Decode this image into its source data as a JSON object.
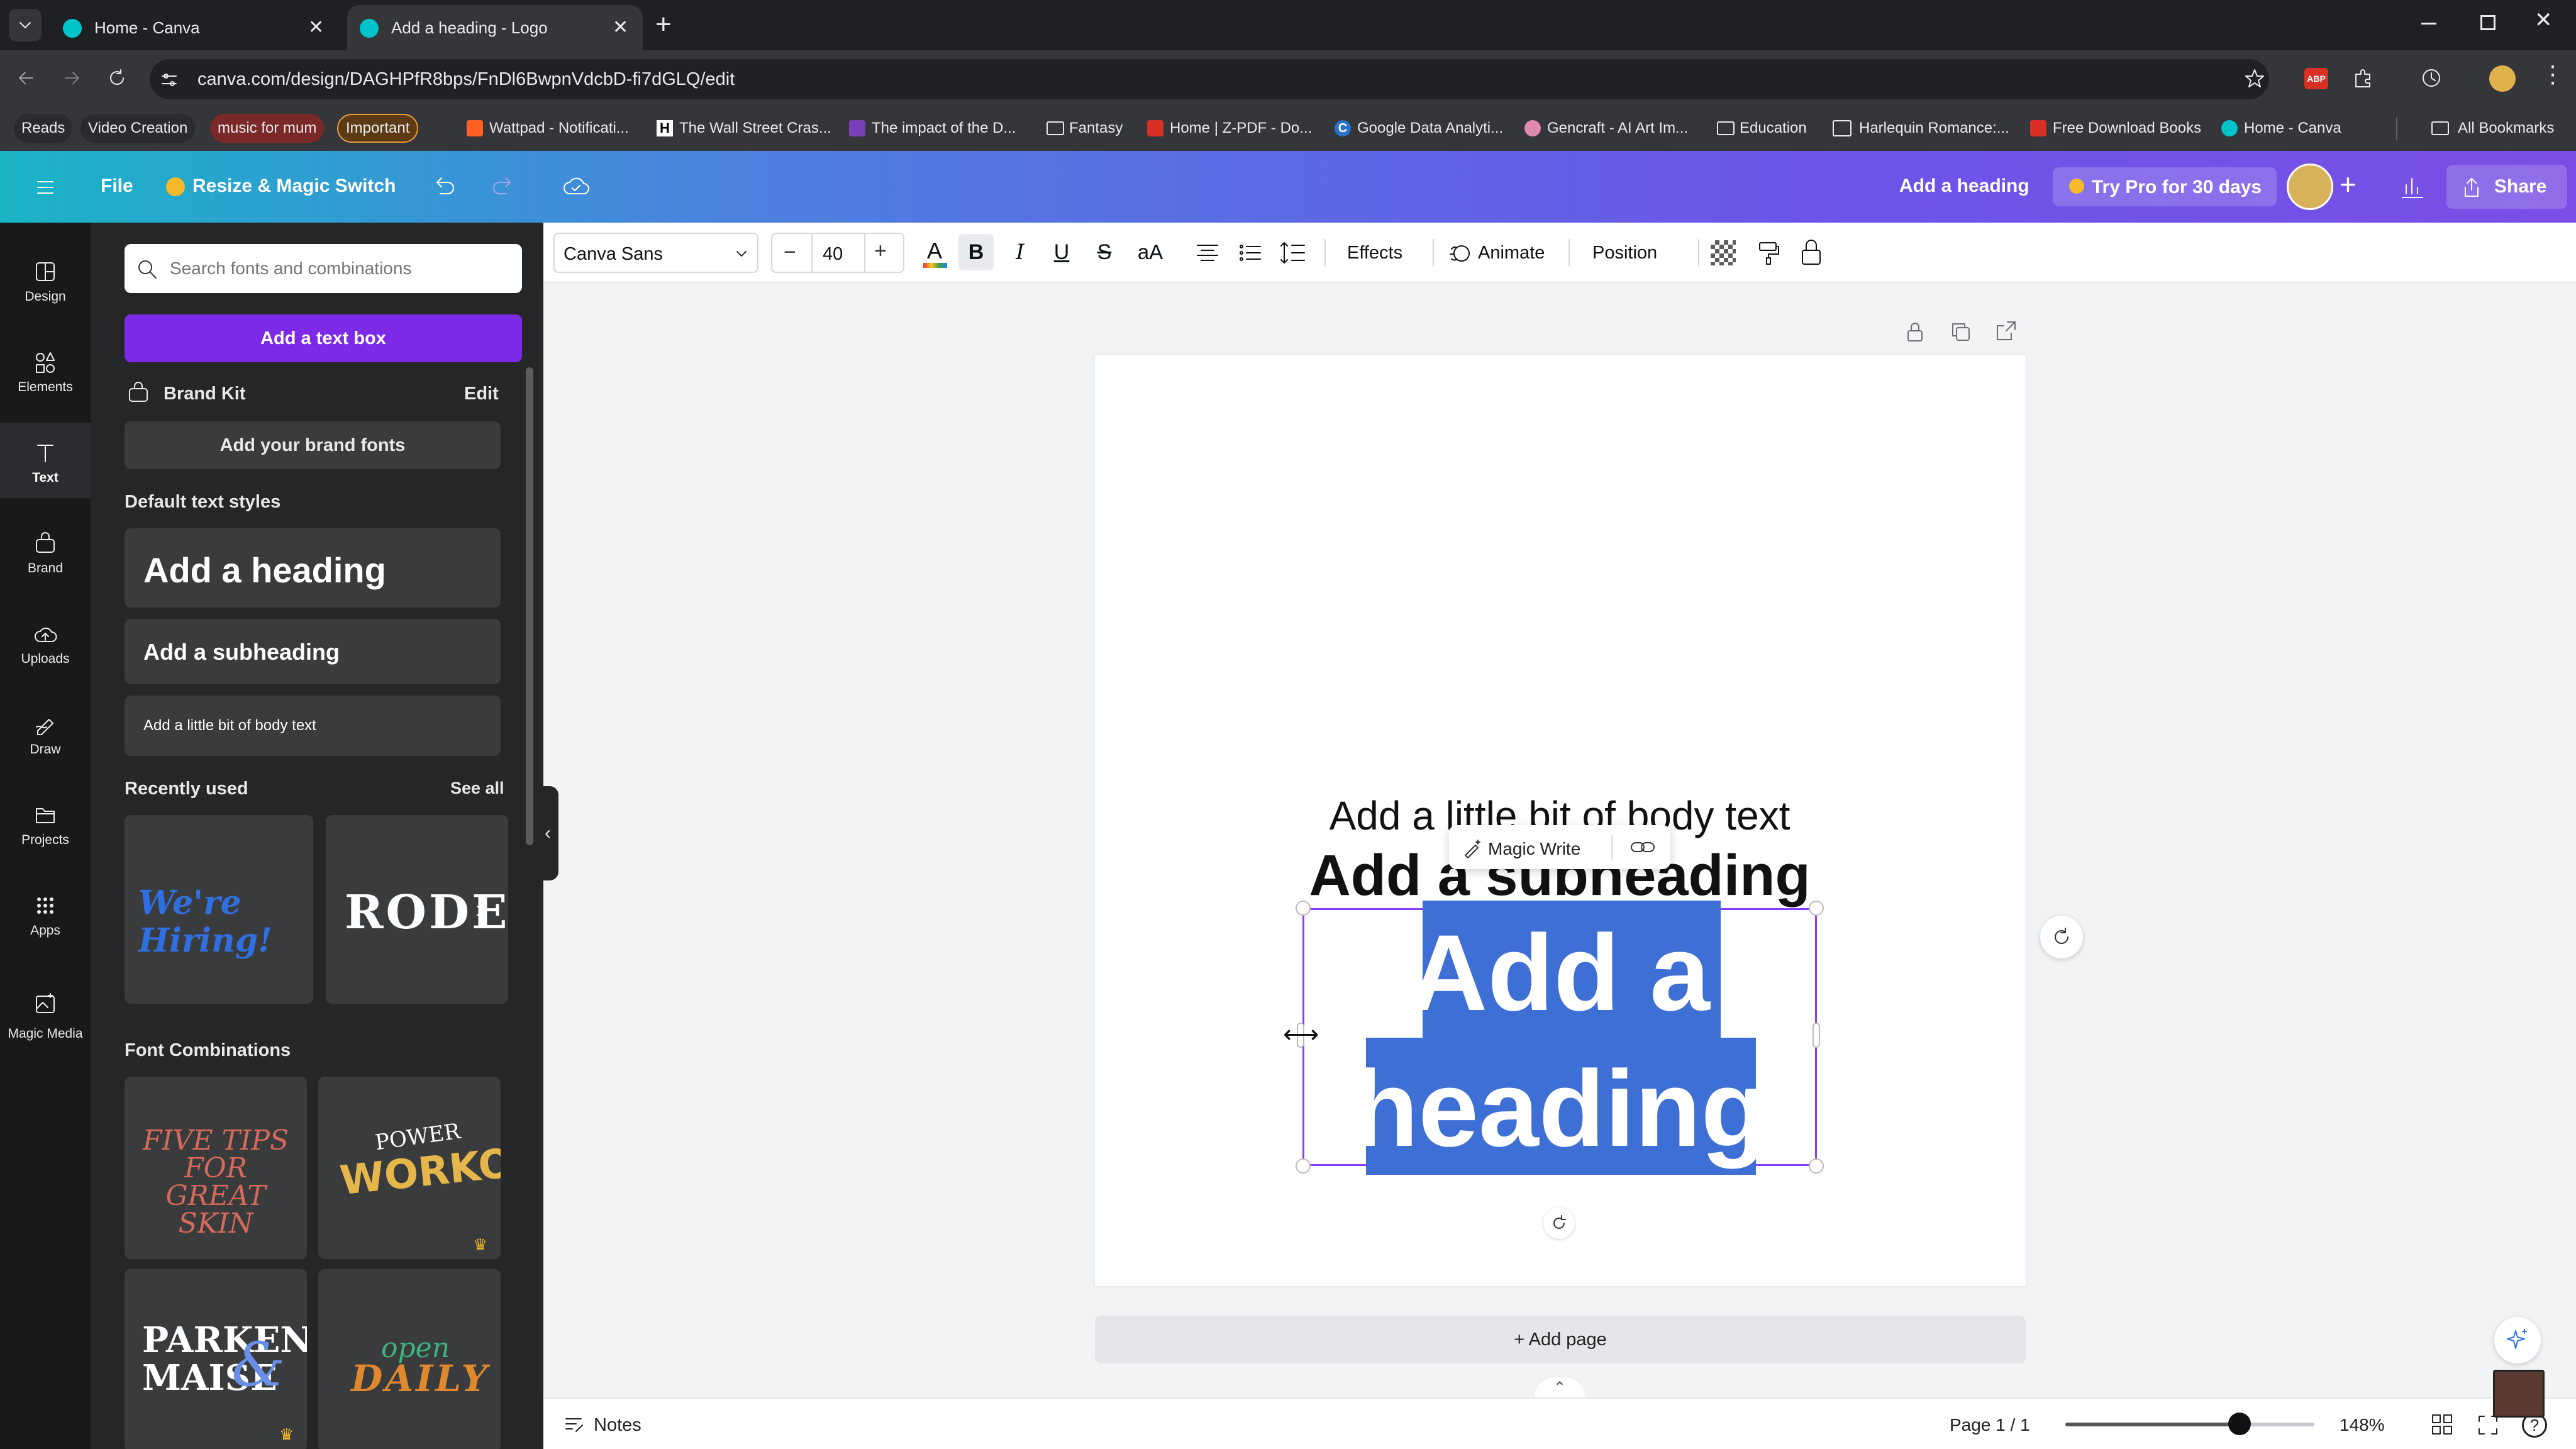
{
  "browser": {
    "tabs": [
      {
        "title": "Home - Canva",
        "active": false
      },
      {
        "title": "Add a heading - Logo",
        "active": true
      }
    ],
    "url": "canva.com/design/DAGHPfR8bps/FnDl6BwpnVdcbD-fi7dGLQ/edit",
    "bookmarks": [
      "Reads",
      "Video Creation",
      "music for mum",
      "Important",
      "Wattpad - Notificati...",
      "The Wall Street Cras...",
      "The impact of the D...",
      "Fantasy",
      "Home | Z-PDF - Do...",
      "Google Data Analyti...",
      "Gencraft - AI Art Im...",
      "Education",
      "Harlequin Romance:...",
      "Free Download Books",
      "Home - Canva"
    ],
    "all_bookmarks": "All Bookmarks",
    "ext_badge": "ABP"
  },
  "header": {
    "file": "File",
    "resize": "Resize & Magic Switch",
    "title": "Add a heading",
    "try_pro": "Try Pro for 30 days",
    "share": "Share"
  },
  "rail": [
    "Design",
    "Elements",
    "Text",
    "Brand",
    "Uploads",
    "Draw",
    "Projects",
    "Apps",
    "Magic Media"
  ],
  "panel": {
    "search_placeholder": "Search fonts and combinations",
    "add_text_box": "Add a text box",
    "brand_kit": "Brand Kit",
    "edit": "Edit",
    "add_brand_fonts": "Add your brand fonts",
    "default_styles": "Default text styles",
    "heading": "Add a heading",
    "subheading": "Add a subheading",
    "body": "Add a little bit of body text",
    "recently_used": "Recently used",
    "see_all": "See all",
    "recent": [
      "We're Hiring!",
      "RODEO"
    ],
    "font_combinations": "Font Combinations",
    "combos": {
      "c1": "FIVE TIPS FOR GREAT SKIN",
      "c2a": "POWER",
      "c2b": "WORKOUT",
      "c3a": "PARKEN",
      "c3b": "MAISE",
      "c4a": "open",
      "c4b": "DAILY"
    }
  },
  "toolbar": {
    "font": "Canva Sans",
    "size": "40",
    "case": "aA",
    "effects": "Effects",
    "animate": "Animate",
    "position": "Position"
  },
  "canvas": {
    "body": "Add a little bit of body text",
    "subheading": "Add a subheading",
    "heading_line1": "Add a",
    "heading_line2": "heading",
    "magic_write": "Magic Write",
    "add_page": "+ Add page"
  },
  "footer": {
    "notes": "Notes",
    "page": "Page 1 / 1",
    "zoom": "148%",
    "zoom_level": 0.7
  },
  "colors": {
    "accent": "#8b3dff",
    "highlight": "#3d6fd4"
  }
}
